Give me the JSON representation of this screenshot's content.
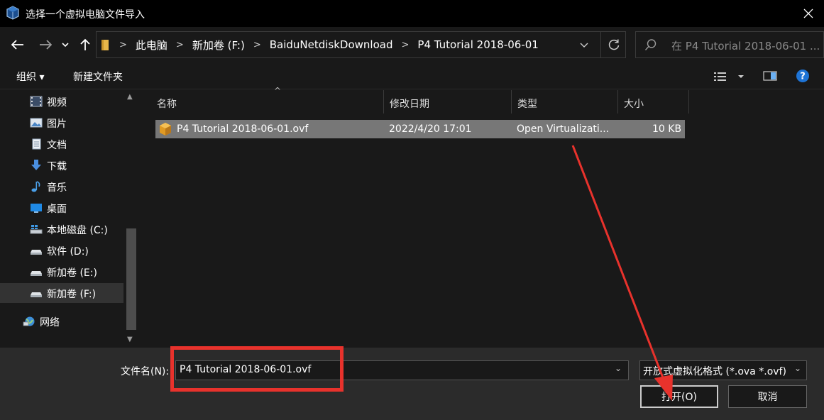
{
  "window": {
    "title": "选择一个虚拟电脑文件导入"
  },
  "address": {
    "crumbs": [
      "此电脑",
      "新加卷 (F:)",
      "BaiduNetdiskDownload",
      "P4 Tutorial 2018-06-01"
    ]
  },
  "search": {
    "placeholder": "在 P4 Tutorial 2018-06-01 ..."
  },
  "toolbar": {
    "organize_label": "组织 ▾",
    "new_folder_label": "新建文件夹"
  },
  "sidebar": {
    "items": [
      {
        "label": "视频",
        "icon": "video-icon"
      },
      {
        "label": "图片",
        "icon": "picture-icon"
      },
      {
        "label": "文档",
        "icon": "document-icon"
      },
      {
        "label": "下载",
        "icon": "download-icon"
      },
      {
        "label": "音乐",
        "icon": "music-icon"
      },
      {
        "label": "桌面",
        "icon": "desktop-icon"
      },
      {
        "label": "本地磁盘 (C:)",
        "icon": "system-drive-icon"
      },
      {
        "label": "软件 (D:)",
        "icon": "drive-icon"
      },
      {
        "label": "新加卷 (E:)",
        "icon": "drive-icon"
      },
      {
        "label": "新加卷 (F:)",
        "icon": "drive-icon",
        "selected": true
      },
      {
        "label": "网络",
        "icon": "network-icon"
      }
    ]
  },
  "filelist": {
    "columns": [
      "名称",
      "修改日期",
      "类型",
      "大小"
    ],
    "rows": [
      {
        "name": "P4 Tutorial 2018-06-01.ovf",
        "modified": "2022/4/20 17:01",
        "type": "Open Virtualizati...",
        "size": "10 KB"
      }
    ]
  },
  "bottom": {
    "filename_label": "文件名(N):",
    "filename_value": "P4 Tutorial 2018-06-01.ovf",
    "filter_value": "开放式虚拟化格式 (*.ova *.ovf)",
    "open_label": "打开(O)",
    "cancel_label": "取消"
  },
  "colors": {
    "background": "#191919",
    "titlebar": "#000000",
    "selection": "#777777",
    "bottom_panel": "#2b2b2b",
    "annotation": "#e8322c",
    "help_blue": "#1e74d6"
  }
}
